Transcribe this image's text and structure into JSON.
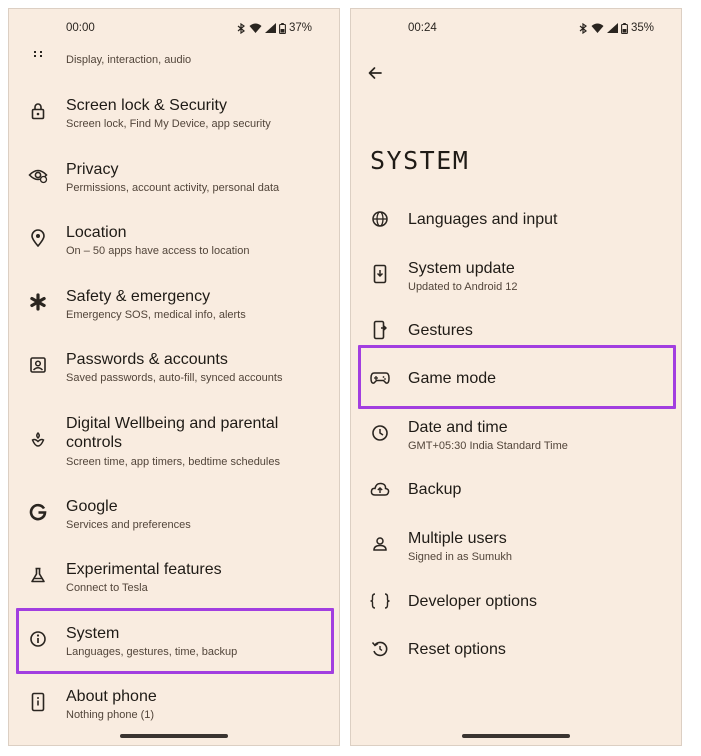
{
  "left": {
    "status": {
      "time": "00:00",
      "battery": "37%"
    },
    "partial_item": {
      "subtitle": "Display, interaction, audio",
      "icon": "sound-vibration-icon"
    },
    "items": [
      {
        "title": "Screen lock & Security",
        "subtitle": "Screen lock, Find My Device, app security",
        "icon": "lock-icon"
      },
      {
        "title": "Privacy",
        "subtitle": "Permissions, account activity, personal data",
        "icon": "eye-icon"
      },
      {
        "title": "Location",
        "subtitle": "On – 50 apps have access to location",
        "icon": "location-pin-icon"
      },
      {
        "title": "Safety & emergency",
        "subtitle": "Emergency SOS, medical info, alerts",
        "icon": "asterisk-icon"
      },
      {
        "title": "Passwords & accounts",
        "subtitle": "Saved passwords, auto-fill, synced accounts",
        "icon": "account-box-icon"
      },
      {
        "title_line1": "Digital Wellbeing and parental",
        "title_line2": "controls",
        "subtitle": "Screen time, app timers, bedtime schedules",
        "icon": "wellbeing-icon"
      },
      {
        "title": "Google",
        "subtitle": "Services and preferences",
        "icon": "google-g-icon"
      },
      {
        "title": "Experimental features",
        "subtitle": "Connect to Tesla",
        "icon": "flask-icon"
      },
      {
        "title": "System",
        "subtitle": "Languages, gestures, time, backup",
        "icon": "info-icon"
      },
      {
        "title": "About phone",
        "subtitle": "Nothing phone (1)",
        "icon": "phone-info-icon"
      }
    ]
  },
  "right": {
    "status": {
      "time": "00:24",
      "battery": "35%"
    },
    "page_title": "SYSTEM",
    "items": [
      {
        "title": "Languages and input",
        "subtitle": "",
        "icon": "globe-icon"
      },
      {
        "title": "System update",
        "subtitle": "Updated to Android 12",
        "icon": "system-update-icon"
      },
      {
        "title": "Gestures",
        "subtitle": "",
        "icon": "gestures-icon"
      },
      {
        "title": "Game mode",
        "subtitle": "",
        "icon": "gamepad-icon"
      },
      {
        "title": "Date and time",
        "subtitle": "GMT+05:30 India Standard Time",
        "icon": "clock-icon"
      },
      {
        "title": "Backup",
        "subtitle": "",
        "icon": "cloud-upload-icon"
      },
      {
        "title": "Multiple users",
        "subtitle": "Signed in as Sumukh",
        "icon": "person-icon"
      },
      {
        "title": "Developer options",
        "subtitle": "",
        "icon": "braces-icon"
      },
      {
        "title": "Reset options",
        "subtitle": "",
        "icon": "reset-icon"
      }
    ]
  },
  "colors": {
    "background": "#f9ece0",
    "highlight": "#a23ee0",
    "text": "#1f1b16",
    "subtext": "#52453a"
  }
}
